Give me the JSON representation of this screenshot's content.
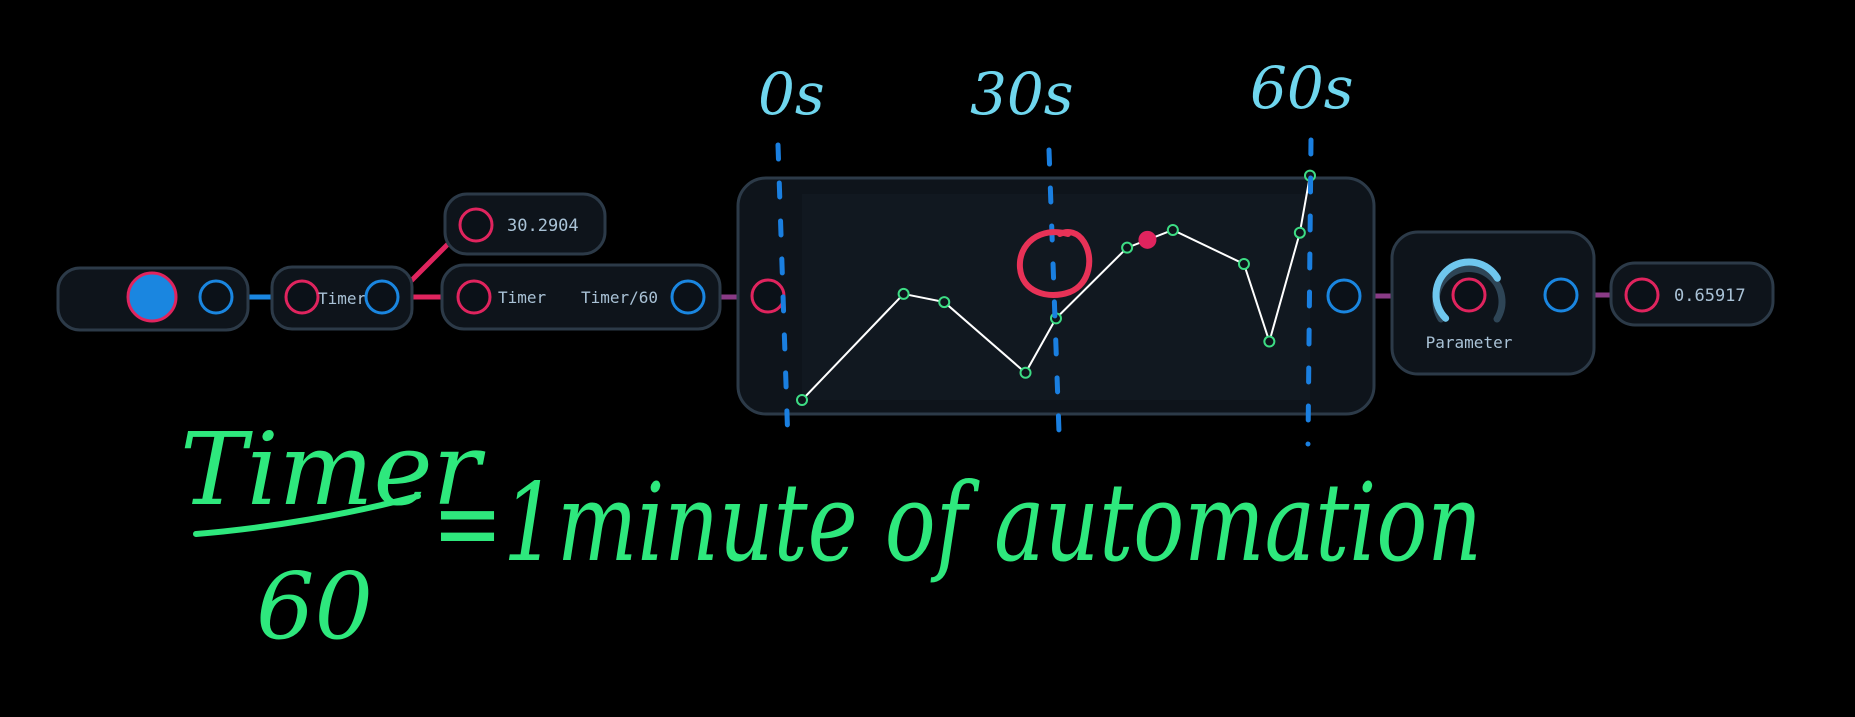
{
  "colors": {
    "background": "#000000",
    "node_fill": "#0e141b",
    "node_border": "#2c3a48",
    "port_blue": "#1a86e0",
    "port_red": "#e0245e",
    "annotation_green": "#2ee87d",
    "annotation_cyan": "#6fd6ee",
    "annotation_blue": "#1a7fe0",
    "curve": "#ffffff"
  },
  "nodes": {
    "trigger": {
      "icon": "record-button-icon"
    },
    "timer_source": {
      "label": "Timer"
    },
    "display": {
      "value": "30.2904"
    },
    "expression": {
      "input_label": "Timer",
      "output_label": "Timer/60"
    },
    "automation": {
      "points": [
        [
          0.0,
          0.0
        ],
        [
          0.2,
          0.78
        ],
        [
          0.28,
          0.72
        ],
        [
          0.44,
          0.2
        ],
        [
          0.5,
          0.6
        ],
        [
          0.64,
          1.12
        ],
        [
          0.73,
          1.25
        ],
        [
          0.87,
          1.0
        ],
        [
          0.92,
          0.43
        ],
        [
          0.98,
          1.23
        ],
        [
          1.0,
          1.65
        ]
      ],
      "markers": [
        "0s",
        "30s",
        "60s"
      ],
      "playhead": 0.68
    },
    "parameter": {
      "label": "Parameter",
      "knob_level": 0.72
    },
    "output": {
      "value": "0.65917"
    }
  },
  "annotations": {
    "numerator": "Timer",
    "denominator": "60",
    "equation": "=1minute of automation"
  }
}
